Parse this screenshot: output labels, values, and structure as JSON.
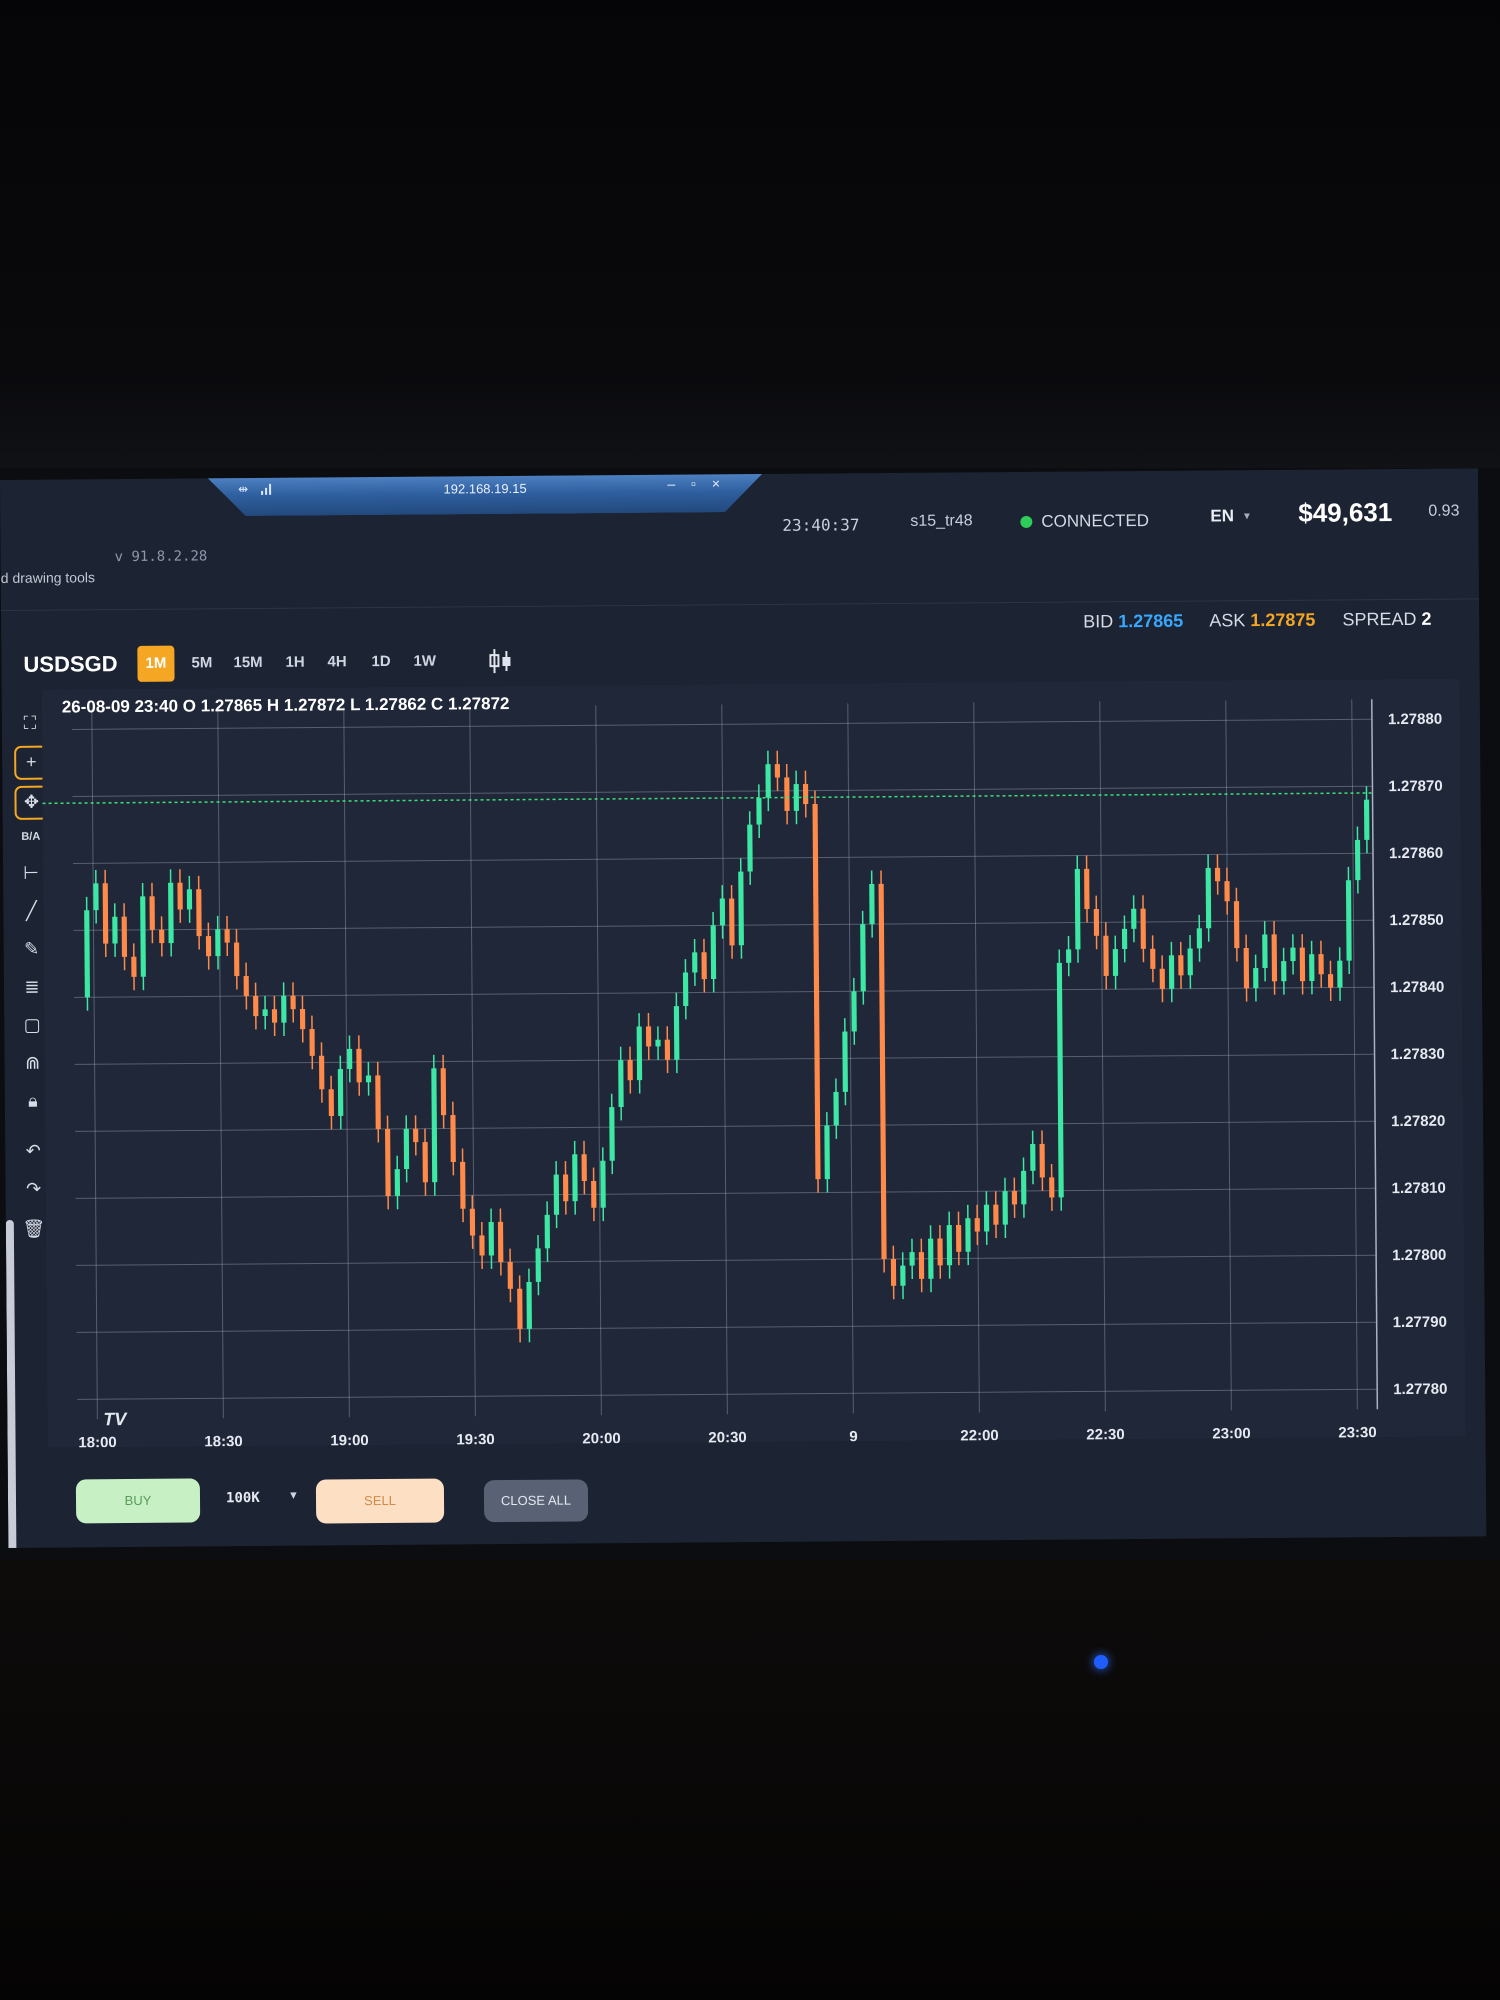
{
  "window": {
    "title": "192.168.19.15",
    "controls": "– ▫ ×"
  },
  "header": {
    "version": "v 91.8.2.28",
    "drawing_tools_hint": "d drawing tools",
    "clock": "23:40:37",
    "user_id": "s15_tr48",
    "connection_status": "CONNECTED",
    "language": "EN",
    "balance": "$49,631",
    "margin_value": "0.93"
  },
  "symbol": "USDSGD",
  "timeframes": [
    {
      "label": "1M",
      "active": true
    },
    {
      "label": "5M",
      "active": false
    },
    {
      "label": "15M",
      "active": false
    },
    {
      "label": "1H",
      "active": false
    },
    {
      "label": "4H",
      "active": false
    },
    {
      "label": "1D",
      "active": false
    },
    {
      "label": "1W",
      "active": false
    }
  ],
  "quote": {
    "bid_label": "BID",
    "bid": "1.27865",
    "ask_label": "ASK",
    "ask": "1.27875",
    "spread_label": "SPREAD",
    "spread": "2"
  },
  "drawing_tools": [
    {
      "icon": "fullscreen-icon"
    },
    {
      "icon": "crosshair-icon"
    },
    {
      "icon": "move-icon"
    },
    {
      "icon": "bid-ask-toggle",
      "label": "B/A"
    },
    {
      "icon": "measure-icon"
    },
    {
      "icon": "trendline-icon"
    },
    {
      "icon": "pencil-icon"
    },
    {
      "icon": "fibonacci-icon"
    },
    {
      "icon": "rectangle-icon"
    },
    {
      "icon": "magnet-icon"
    },
    {
      "icon": "lock-icon"
    },
    {
      "icon": "undo-icon"
    },
    {
      "icon": "redo-icon"
    },
    {
      "icon": "trash-icon"
    }
  ],
  "ohlc_legend": "26-08-09 23:40 O 1.27865 H 1.27872 L 1.27862 C 1.27872",
  "colors": {
    "up": "#3de8a4",
    "down": "#ff8a4a",
    "accent": "#f5a623",
    "bid": "#38a8ff",
    "chart_bg": "#1f2738",
    "grid": "#9aa3b5",
    "price_line": "#3fe07a"
  },
  "trade_bar": {
    "buy_label": "BUY",
    "lot_size": "100K",
    "sell_label": "SELL",
    "close_all_label": "CLOSE ALL"
  },
  "chart_data": {
    "type": "candlestick",
    "title": "",
    "y_ticks": [
      "1.27880",
      "1.27870",
      "1.27860",
      "1.27850",
      "1.27840",
      "1.27830",
      "1.27820",
      "1.27810",
      "1.27800",
      "1.27790",
      "1.27780"
    ],
    "x_ticks": [
      "18:00",
      "18:30",
      "19:00",
      "19:30",
      "20:00",
      "20:30",
      "9",
      "22:00",
      "22:30",
      "23:00",
      "23:30"
    ],
    "ylim": [
      1.2778,
      1.2788
    ],
    "current_price": 1.27869,
    "grid": true,
    "series": [
      {
        "values": [
          1.2784,
          1.27853,
          1.27857,
          1.27848,
          1.27852,
          1.27846,
          1.27843,
          1.27855,
          1.2785,
          1.27848,
          1.27857,
          1.27853,
          1.27856,
          1.27849,
          1.27846,
          1.2785,
          1.27848,
          1.27843,
          1.2784,
          1.27837,
          1.27838,
          1.27836,
          1.2784,
          1.27838,
          1.27835,
          1.27831,
          1.27826,
          1.27822,
          1.27829,
          1.27832,
          1.27827,
          1.27828,
          1.2782,
          1.2781,
          1.27814,
          1.2782,
          1.27818,
          1.27812,
          1.27829,
          1.27822,
          1.27815,
          1.27808,
          1.27804,
          1.27801,
          1.27806,
          1.278,
          1.27796,
          1.2779,
          1.27797,
          1.27802,
          1.27807,
          1.27813,
          1.27809,
          1.27816,
          1.27812,
          1.27808,
          1.27815,
          1.27823,
          1.2783,
          1.27827,
          1.27835,
          1.27832,
          1.27833,
          1.2783,
          1.27838,
          1.27843,
          1.27846,
          1.27842,
          1.2785,
          1.27854,
          1.27847,
          1.27858,
          1.27865,
          1.27869,
          1.27874,
          1.27872,
          1.27867,
          1.27871,
          1.27868,
          1.27812,
          1.2782,
          1.27825,
          1.27834,
          1.2784,
          1.2785,
          1.27856,
          1.278,
          1.27796,
          1.27799,
          1.27801,
          1.27797,
          1.27803,
          1.27799,
          1.27805,
          1.27801,
          1.27806,
          1.27804,
          1.27808,
          1.27805,
          1.2781,
          1.27808,
          1.27813,
          1.27817,
          1.27812,
          1.27809,
          1.27844,
          1.27846,
          1.27858,
          1.27852,
          1.27848,
          1.27842,
          1.27846,
          1.27849,
          1.27852,
          1.27846,
          1.27843,
          1.2784,
          1.27845,
          1.27842,
          1.27846,
          1.27849,
          1.27858,
          1.27856,
          1.27853,
          1.27846,
          1.2784,
          1.27843,
          1.27848,
          1.27841,
          1.27844,
          1.27846,
          1.27841,
          1.27845,
          1.27842,
          1.2784,
          1.27844,
          1.27856,
          1.27862,
          1.27868
        ]
      }
    ]
  }
}
